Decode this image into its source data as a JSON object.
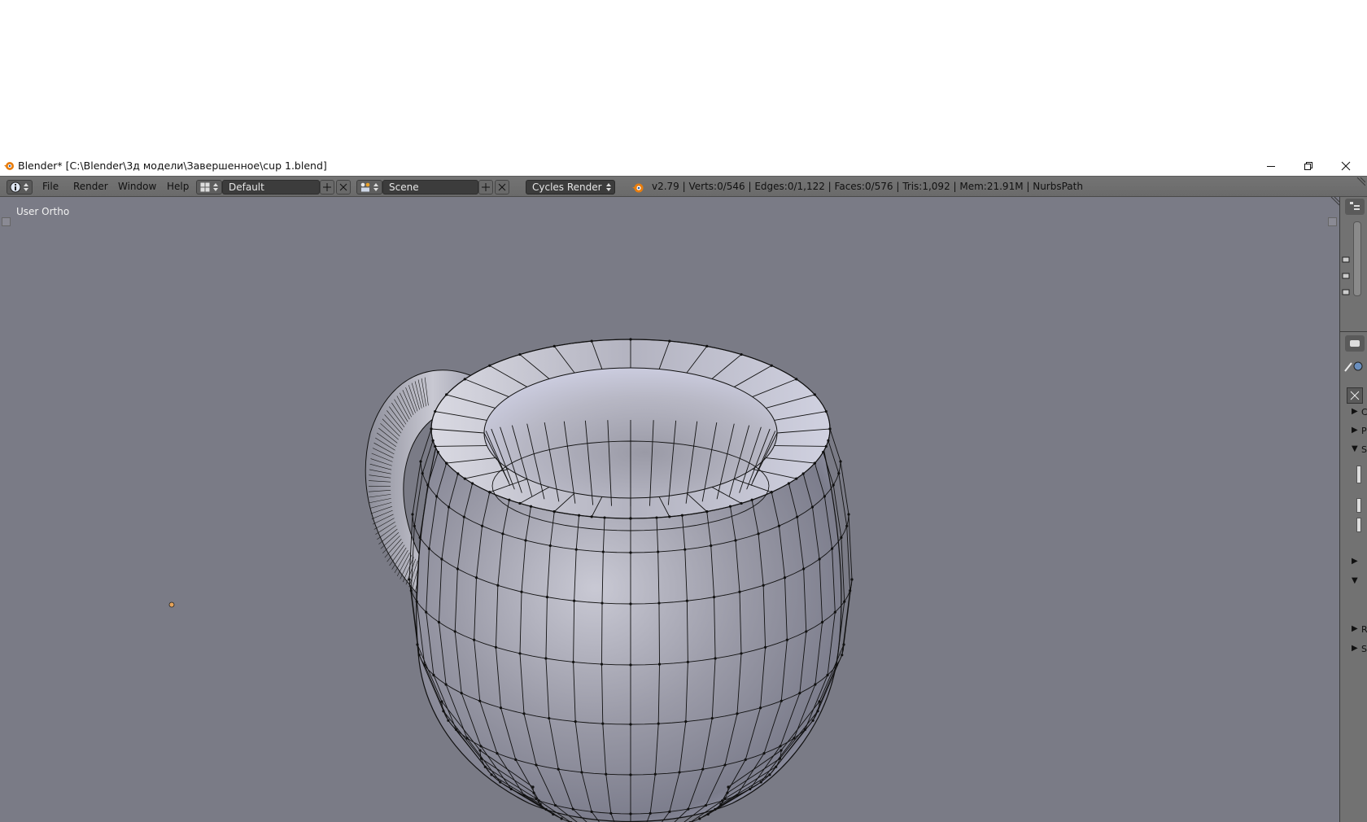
{
  "window": {
    "title": "Blender* [C:\\Blender\\3д модели\\Завершенное\\cup 1.blend]"
  },
  "header": {
    "menus": [
      "File",
      "Render",
      "Window",
      "Help"
    ],
    "screen_layout": "Default",
    "scene": "Scene",
    "render_engine": "Cycles Render",
    "stats": "v2.79 | Verts:0/546 | Edges:0/1,122 | Faces:0/576 | Tris:1,092 | Mem:21.91M | NurbsPath"
  },
  "viewport": {
    "view_label": "User Ortho",
    "background_color": "#7a7b86"
  },
  "properties_panel": {
    "collapsed_labels": [
      "C",
      "P",
      "S",
      "",
      "",
      "R",
      "S"
    ]
  },
  "icons": [
    "blender-logo-icon",
    "info-editor-icon",
    "screen-layout-icon",
    "scene-icon",
    "add-icon",
    "close-icon",
    "minimize-icon",
    "restore-icon",
    "window-close-icon"
  ]
}
